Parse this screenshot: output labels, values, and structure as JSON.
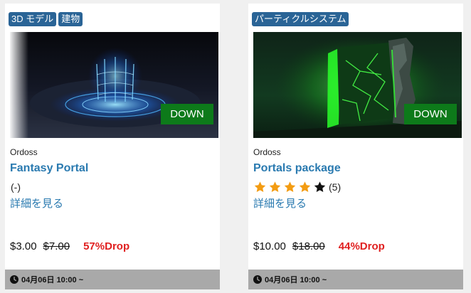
{
  "cards": [
    {
      "tags": [
        "3D モデル",
        "建物"
      ],
      "badge": "DOWN",
      "author": "Ordoss",
      "title": "Fantasy Portal",
      "rating_text": "(-)",
      "rating_stars": null,
      "detail_label": "詳細を見る",
      "price": "$3.00",
      "old_price": "$7.00",
      "drop": "57%Drop",
      "sale_start": "04月06日 10:00 ~",
      "thumbnail": "blue-crystal-portal-image"
    },
    {
      "tags": [
        "パーティクルシステム"
      ],
      "badge": "DOWN",
      "author": "Ordoss",
      "title": "Portals package",
      "rating_text": "(5)",
      "rating_stars": 4,
      "detail_label": "詳細を見る",
      "price": "$10.00",
      "old_price": "$18.00",
      "drop": "44%Drop",
      "sale_start": "04月06日 10:00 ~",
      "thumbnail": "green-stone-portal-image"
    }
  ],
  "colors": {
    "tag_bg": "#2a6496",
    "badge_bg": "#0d7a1a",
    "link": "#2a7ab0",
    "drop": "#e02020",
    "footer_bg": "#a9a9a9",
    "star_filled": "#f39c12",
    "star_empty": "#111111"
  },
  "icons": [
    "star-icon",
    "clock-icon"
  ]
}
